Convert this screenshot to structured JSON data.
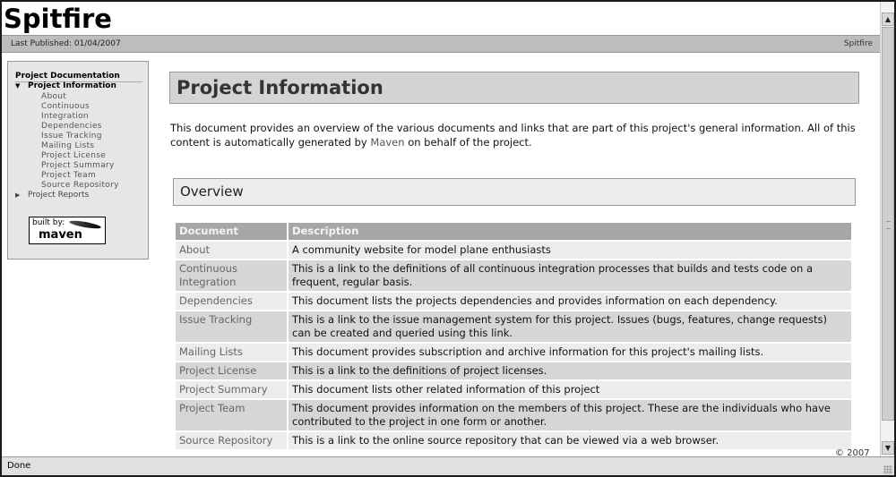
{
  "site": {
    "title": "Spitfire",
    "last_published": "Last Published: 01/04/2007",
    "breadcrumb_right": "Spitfire"
  },
  "sidebar": {
    "heading": "Project Documentation",
    "groups": [
      {
        "label": "Project Information",
        "expanded": true,
        "icon": "triangle-down-icon",
        "items": [
          {
            "label": "About"
          },
          {
            "label": "Continuous"
          },
          {
            "label": "Integration"
          },
          {
            "label": "Dependencies"
          },
          {
            "label": "Issue Tracking"
          },
          {
            "label": "Mailing Lists"
          },
          {
            "label": "Project License"
          },
          {
            "label": "Project Summary"
          },
          {
            "label": "Project Team"
          },
          {
            "label": "Source Repository"
          }
        ]
      },
      {
        "label": "Project Reports",
        "expanded": false,
        "icon": "triangle-right-icon"
      }
    ],
    "badge": {
      "built_by": "built by:",
      "name": "maven"
    }
  },
  "main": {
    "title": "Project Information",
    "intro_before": "This document provides an overview of the various documents and links that are part of this project's general information. All of this content is automatically generated by ",
    "intro_link": "Maven",
    "intro_after": " on behalf of the project.",
    "section_title": "Overview",
    "table": {
      "headers": [
        "Document",
        "Description"
      ],
      "rows": [
        {
          "document": "About",
          "description": "A community website for model plane enthusiasts"
        },
        {
          "document": "Continuous Integration",
          "description": "This is a link to the definitions of all continuous integration processes that builds and tests code on a frequent, regular basis."
        },
        {
          "document": "Dependencies",
          "description": "This document lists the projects dependencies and provides information on each dependency."
        },
        {
          "document": "Issue Tracking",
          "description": "This is a link to the issue management system for this project. Issues (bugs, features, change requests) can be created and queried using this link."
        },
        {
          "document": "Mailing Lists",
          "description": "This document provides subscription and archive information for this project's mailing lists."
        },
        {
          "document": "Project License",
          "description": "This is a link to the definitions of project licenses."
        },
        {
          "document": "Project Summary",
          "description": "This document lists other related information of this project"
        },
        {
          "document": "Project Team",
          "description": "This document provides information on the members of this project. These are the individuals who have contributed to the project in one form or another."
        },
        {
          "document": "Source Repository",
          "description": "This is a link to the online source repository that can be viewed via a web browser."
        }
      ]
    },
    "footer": "© 2007"
  },
  "statusbar": {
    "text": "Done"
  },
  "scrollbar": {
    "up_icon": "chevron-up-icon",
    "down_icon": "chevron-down-icon",
    "up_glyph": "▲",
    "down_glyph": "▼"
  },
  "icons": {
    "expanded_glyph": "▼",
    "collapsed_glyph": "▶"
  },
  "colors": {
    "table_header_bg": "#a7a7a7",
    "row_light": "#ececec",
    "row_dark": "#d6d6d6",
    "heading_bg": "#d4d4d4",
    "breadcrumb_bg": "#bdbdbd"
  }
}
